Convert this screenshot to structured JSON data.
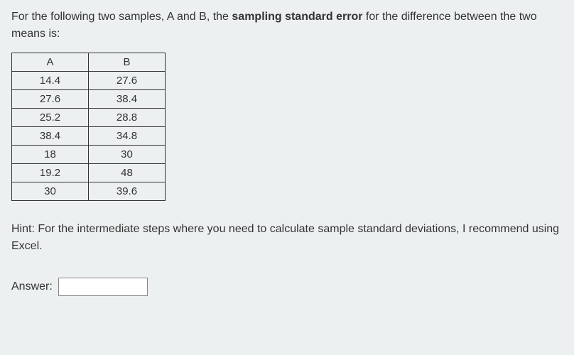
{
  "question": {
    "prefix": "For the following two samples, A and B, the ",
    "bold": "sampling standard error",
    "suffix": " for the difference between the two means is:"
  },
  "table": {
    "headers": [
      "A",
      "B"
    ],
    "rows": [
      [
        "14.4",
        "27.6"
      ],
      [
        "27.6",
        "38.4"
      ],
      [
        "25.2",
        "28.8"
      ],
      [
        "38.4",
        "34.8"
      ],
      [
        "18",
        "30"
      ],
      [
        "19.2",
        "48"
      ],
      [
        "30",
        "39.6"
      ]
    ]
  },
  "hint": "Hint: For the intermediate steps where you need to calculate sample standard deviations, I recommend using Excel.",
  "answer": {
    "label": "Answer:",
    "value": ""
  }
}
